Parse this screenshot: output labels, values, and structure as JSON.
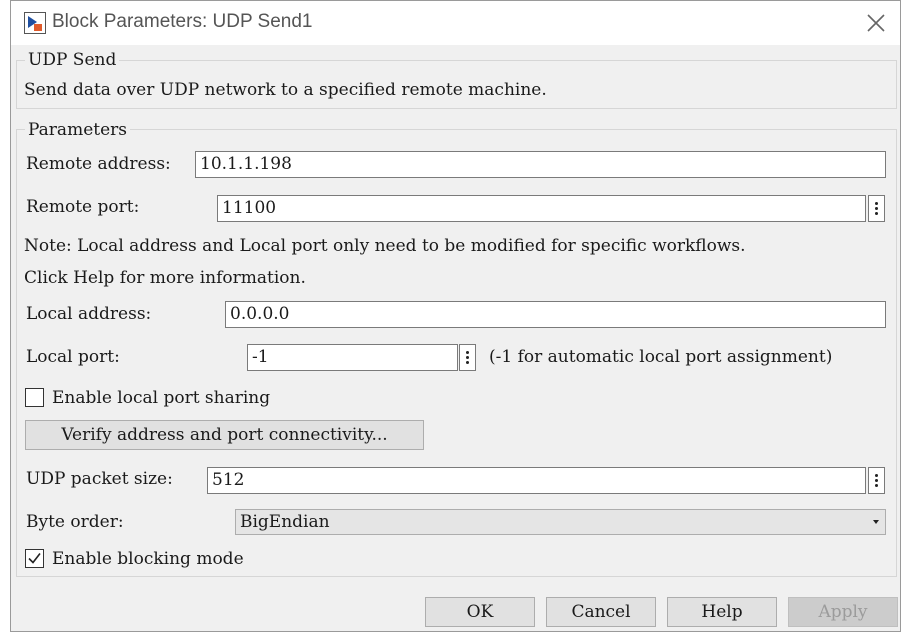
{
  "window": {
    "title": "Block Parameters: UDP Send1"
  },
  "description_group": {
    "title": "UDP Send",
    "text": "Send data over UDP network to a specified remote machine."
  },
  "parameters_group": {
    "title": "Parameters",
    "remote_address": {
      "label": "Remote address:",
      "value": "10.1.1.198"
    },
    "remote_port": {
      "label": "Remote port:",
      "value": "11100"
    },
    "note_line1": "Note: Local address and Local port only need to be modified for specific workflows.",
    "note_line2": "Click Help for more information.",
    "local_address": {
      "label": "Local address:",
      "value": "0.0.0.0"
    },
    "local_port": {
      "label": "Local port:",
      "value": "-1",
      "hint": "(-1 for automatic local port assignment)"
    },
    "local_port_sharing": {
      "label": "Enable local port sharing",
      "checked": false
    },
    "verify_button": "Verify address and port connectivity...",
    "packet_size": {
      "label": "UDP packet size:",
      "value": "512"
    },
    "byte_order": {
      "label": "Byte order:",
      "value": "BigEndian"
    },
    "blocking_mode": {
      "label": "Enable blocking mode",
      "checked": true
    }
  },
  "buttons": {
    "ok": "OK",
    "cancel": "Cancel",
    "help": "Help",
    "apply": "Apply"
  }
}
